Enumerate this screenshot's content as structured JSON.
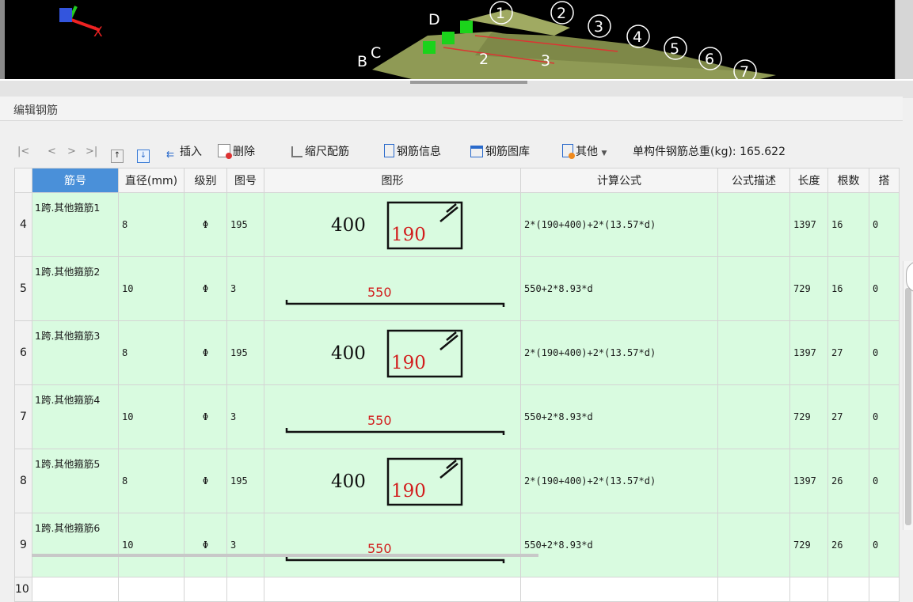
{
  "viewport": {
    "axis_label": "X",
    "point_labels": [
      "D",
      "B",
      "C",
      "1",
      "2",
      "3",
      "4",
      "5",
      "6",
      "7",
      "3",
      "2"
    ]
  },
  "panel": {
    "title": "编辑钢筋"
  },
  "toolbar": {
    "nav": [
      "|<",
      "<",
      ">",
      ">|"
    ],
    "insert": "插入",
    "delete": "删除",
    "scale_rebar": "缩尺配筋",
    "rebar_info": "钢筋信息",
    "rebar_library": "钢筋图库",
    "other": "其他",
    "total_weight": "单构件钢筋总重(kg): 165.622"
  },
  "columns": [
    "筋号",
    "直径(mm)",
    "级别",
    "图号",
    "图形",
    "计算公式",
    "公式描述",
    "长度",
    "根数",
    "搭"
  ],
  "rows": [
    {
      "num": "4",
      "name": "1跨.其他箍筋1",
      "dia": "8",
      "grade": "Φ",
      "fig": "195",
      "shape": "stirrup",
      "s1": "400",
      "s2": "190",
      "formula": "2*(190+400)+2*(13.57*d)",
      "desc": "",
      "length": "1397",
      "count": "16",
      "lap": "0"
    },
    {
      "num": "5",
      "name": "1跨.其他箍筋2",
      "dia": "10",
      "grade": "Φ",
      "fig": "3",
      "shape": "bar",
      "s1": "550",
      "formula": "550+2*8.93*d",
      "desc": "",
      "length": "729",
      "count": "16",
      "lap": "0"
    },
    {
      "num": "6",
      "name": "1跨.其他箍筋3",
      "dia": "8",
      "grade": "Φ",
      "fig": "195",
      "shape": "stirrup",
      "s1": "400",
      "s2": "190",
      "formula": "2*(190+400)+2*(13.57*d)",
      "desc": "",
      "length": "1397",
      "count": "27",
      "lap": "0"
    },
    {
      "num": "7",
      "name": "1跨.其他箍筋4",
      "dia": "10",
      "grade": "Φ",
      "fig": "3",
      "shape": "bar",
      "s1": "550",
      "formula": "550+2*8.93*d",
      "desc": "",
      "length": "729",
      "count": "27",
      "lap": "0"
    },
    {
      "num": "8",
      "name": "1跨.其他箍筋5",
      "dia": "8",
      "grade": "Φ",
      "fig": "195",
      "shape": "stirrup",
      "s1": "400",
      "s2": "190",
      "formula": "2*(190+400)+2*(13.57*d)",
      "desc": "",
      "length": "1397",
      "count": "26",
      "lap": "0"
    },
    {
      "num": "9",
      "name": "1跨.其他箍筋6",
      "dia": "10",
      "grade": "Φ",
      "fig": "3",
      "shape": "bar",
      "s1": "550",
      "formula": "550+2*8.93*d",
      "desc": "",
      "length": "729",
      "count": "26",
      "lap": "0"
    }
  ],
  "empty_row_num": "10",
  "colors": {
    "active_header": "#4a90d9",
    "row_bg": "#d9fbe0",
    "dim_red": "#d21c1c"
  }
}
